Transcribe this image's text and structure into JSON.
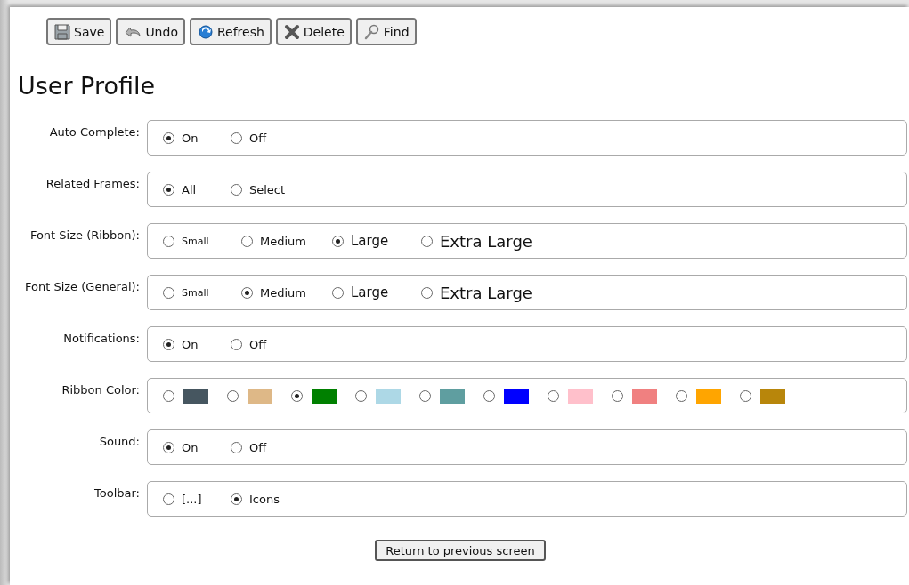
{
  "toolbar": [
    {
      "kind": "save",
      "label": "Save"
    },
    {
      "kind": "undo",
      "label": "Undo"
    },
    {
      "kind": "refresh",
      "label": "Refresh"
    },
    {
      "kind": "delete",
      "label": "Delete"
    },
    {
      "kind": "find",
      "label": "Find"
    }
  ],
  "title": "User Profile",
  "settings": [
    {
      "label": "Auto Complete:",
      "options": [
        {
          "kind": "text",
          "label": "On",
          "selected": true
        },
        {
          "kind": "text",
          "label": "Off",
          "selected": false
        }
      ]
    },
    {
      "label": "Related Frames:",
      "options": [
        {
          "kind": "text",
          "label": "All",
          "selected": true
        },
        {
          "kind": "text",
          "label": "Select",
          "selected": false
        }
      ]
    },
    {
      "label": "Font Size (Ribbon):",
      "options": [
        {
          "kind": "small",
          "label": "Small",
          "selected": false
        },
        {
          "kind": "medium",
          "label": "Medium",
          "selected": false
        },
        {
          "kind": "large",
          "label": "Large",
          "selected": true
        },
        {
          "kind": "xlarge",
          "label": "Extra Large",
          "selected": false
        }
      ]
    },
    {
      "label": "Font Size (General):",
      "options": [
        {
          "kind": "small",
          "label": "Small",
          "selected": false
        },
        {
          "kind": "medium",
          "label": "Medium",
          "selected": true
        },
        {
          "kind": "large",
          "label": "Large",
          "selected": false
        },
        {
          "kind": "xlarge",
          "label": "Extra Large",
          "selected": false
        }
      ]
    },
    {
      "label": "Notifications:",
      "options": [
        {
          "kind": "text",
          "label": "On",
          "selected": true
        },
        {
          "kind": "text",
          "label": "Off",
          "selected": false
        }
      ]
    },
    {
      "label": "Ribbon Color:",
      "options": [
        {
          "kind": "swatch",
          "color": "#465660",
          "selected": false
        },
        {
          "kind": "swatch",
          "color": "#deb887",
          "selected": false
        },
        {
          "kind": "swatch",
          "color": "#008000",
          "selected": true
        },
        {
          "kind": "swatch",
          "color": "#add8e6",
          "selected": false
        },
        {
          "kind": "swatch",
          "color": "#5f9ea0",
          "selected": false
        },
        {
          "kind": "swatch",
          "color": "#0000ff",
          "selected": false
        },
        {
          "kind": "swatch",
          "color": "#ffc0cb",
          "selected": false
        },
        {
          "kind": "swatch",
          "color": "#f08080",
          "selected": false
        },
        {
          "kind": "swatch",
          "color": "#ffa500",
          "selected": false
        },
        {
          "kind": "swatch",
          "color": "#b8860b",
          "selected": false
        }
      ]
    },
    {
      "label": "Sound:",
      "options": [
        {
          "kind": "text",
          "label": "On",
          "selected": true
        },
        {
          "kind": "text",
          "label": "Off",
          "selected": false
        }
      ]
    },
    {
      "label": "Toolbar:",
      "options": [
        {
          "kind": "text",
          "label": "[...]",
          "selected": false
        },
        {
          "kind": "text",
          "label": "Icons",
          "selected": true
        }
      ]
    }
  ],
  "return_button": "Return to previous screen"
}
